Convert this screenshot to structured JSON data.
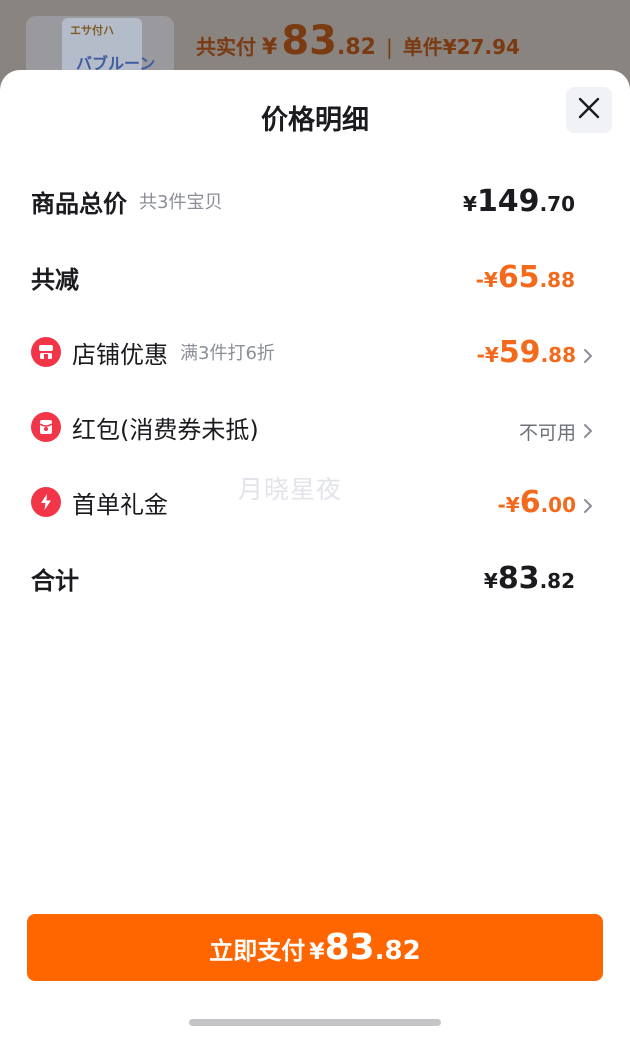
{
  "background": {
    "total_label": "共实付",
    "total_currency": "¥",
    "total_int": "83",
    "total_dec": ".82",
    "separator": "|",
    "unit_label": "单件",
    "unit_price": "¥27.94",
    "product_thumb_text_1": "エサ付ハ",
    "product_thumb_text_2": "バブルーン"
  },
  "sheet": {
    "title": "价格明细",
    "close_icon": "close-icon"
  },
  "rows": {
    "goods_total": {
      "label": "商品总价",
      "sub": "共3件宝贝",
      "currency": "¥",
      "int": "149",
      "dec": ".70"
    },
    "total_reduce": {
      "label": "共减",
      "prefix": "-¥",
      "int": "65",
      "dec": ".88"
    },
    "shop_discount": {
      "icon": "shop-icon",
      "label": "店铺优惠",
      "sub": "满3件打6折",
      "prefix": "-¥",
      "int": "59",
      "dec": ".88"
    },
    "red_packet": {
      "icon": "red-packet-icon",
      "label": "红包(消费券未抵)",
      "status": "不可用"
    },
    "first_order": {
      "icon": "lightning-icon",
      "label": "首单礼金",
      "prefix": "-¥",
      "int": "6",
      "dec": ".00"
    },
    "sum": {
      "label": "合计",
      "currency": "¥",
      "int": "83",
      "dec": ".82"
    }
  },
  "watermark": "月晓星夜",
  "pay_button": {
    "label": "立即支付",
    "currency": "¥",
    "int": "83",
    "dec": ".82"
  },
  "colors": {
    "accent_orange": "#ff6600",
    "amount_orange": "#f36a1d",
    "icon_red": "#f23548"
  }
}
